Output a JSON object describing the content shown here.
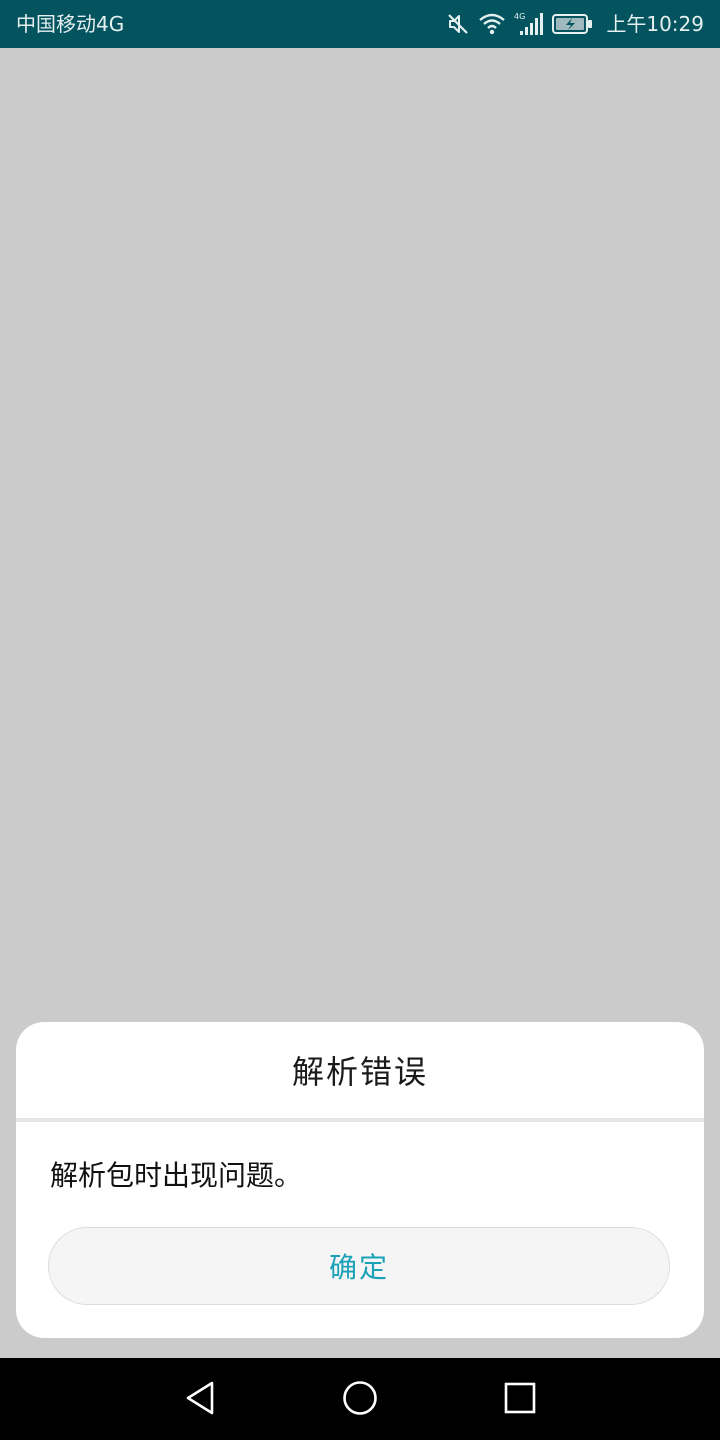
{
  "status_bar": {
    "carrier": "中国移动4G",
    "time": "上午10:29",
    "icons": [
      "mute-icon",
      "wifi-icon",
      "signal-4g-icon",
      "battery-charging-icon"
    ],
    "network_label": "4G",
    "background_color": "#03545e"
  },
  "dialog": {
    "title": "解析错误",
    "message": "解析包时出现问题。",
    "confirm_label": "确定",
    "accent_color": "#1aa1b7"
  },
  "nav_bar": {
    "icons": [
      "back-icon",
      "home-icon",
      "recent-apps-icon"
    ]
  }
}
